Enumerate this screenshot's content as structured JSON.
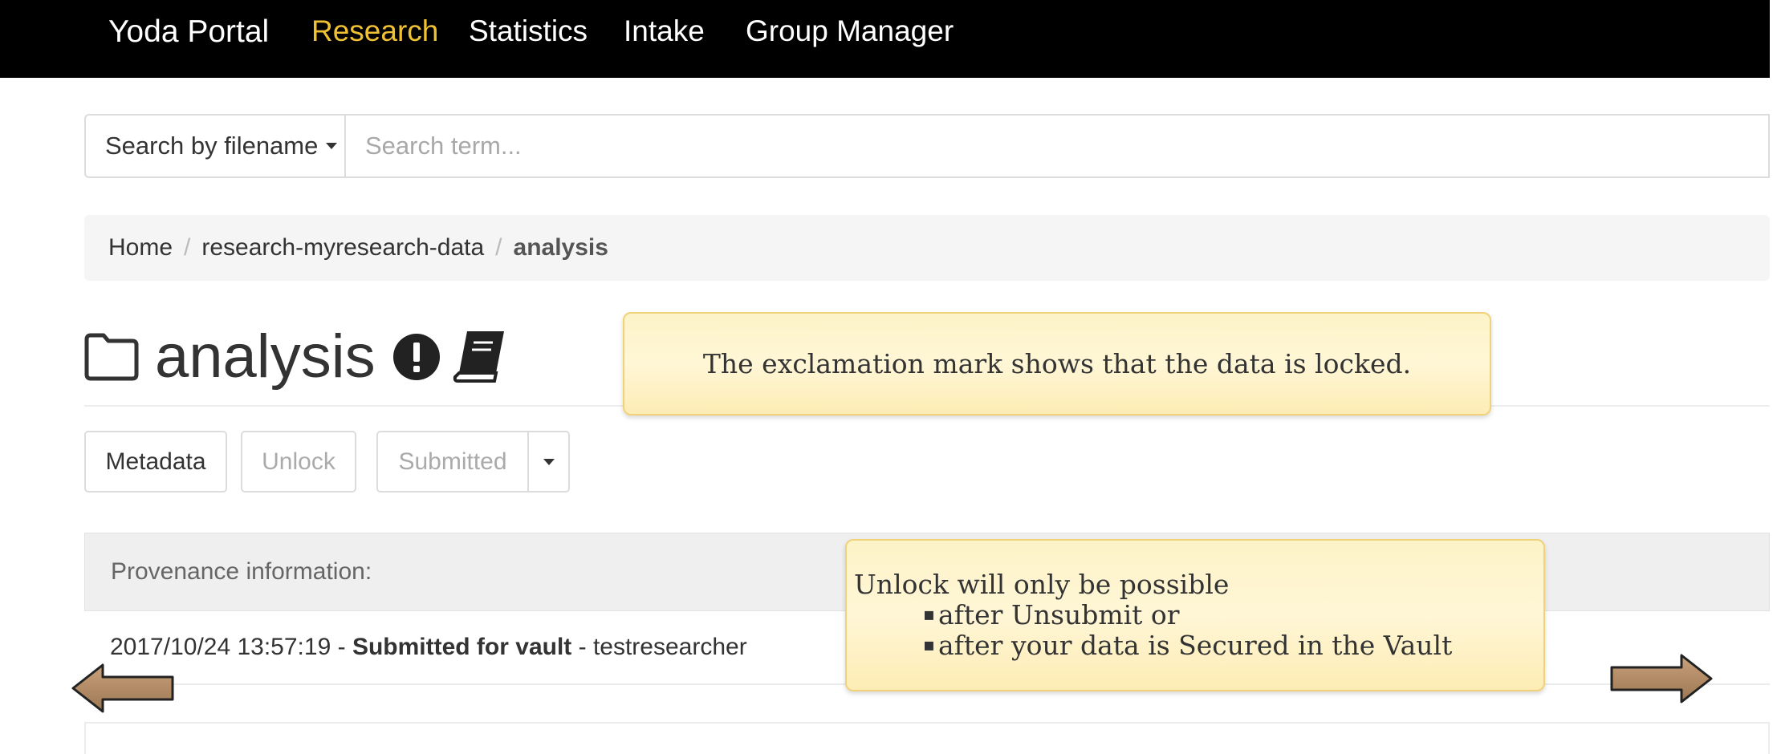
{
  "navbar": {
    "brand": "Yoda Portal",
    "items": [
      {
        "label": "Research",
        "active": true
      },
      {
        "label": "Statistics",
        "active": false
      },
      {
        "label": "Intake",
        "active": false
      },
      {
        "label": "Group Manager",
        "active": false
      }
    ],
    "active_color": "#f0c233"
  },
  "search": {
    "mode_label": "Search by filename",
    "placeholder": "Search term...",
    "value": ""
  },
  "breadcrumb": [
    "Home",
    "research-myresearch-data",
    "analysis"
  ],
  "folder": {
    "title": "analysis",
    "icons": [
      "folder-icon",
      "exclamation-circle-icon",
      "book-icon"
    ]
  },
  "actions": {
    "metadata_label": "Metadata",
    "unlock_label": "Unlock",
    "status_label": "Submitted"
  },
  "provenance": {
    "header": "Provenance information:",
    "entries": [
      {
        "timestamp": "2017/10/24 13:57:19",
        "sep1": " - ",
        "action": "Submitted for vault",
        "sep2": " - ",
        "user": "testresearcher"
      }
    ]
  },
  "tooltips": {
    "locked": "The exclamation mark shows that the data is locked.",
    "unlock_heading": "Unlock will only be possible",
    "unlock_items": [
      "after Unsubmit or",
      "after your data is Secured in the Vault"
    ]
  },
  "navigation": {
    "prev_icon": "left-arrow-icon",
    "next_icon": "right-arrow-icon",
    "arrow_color": "#b4906a"
  }
}
